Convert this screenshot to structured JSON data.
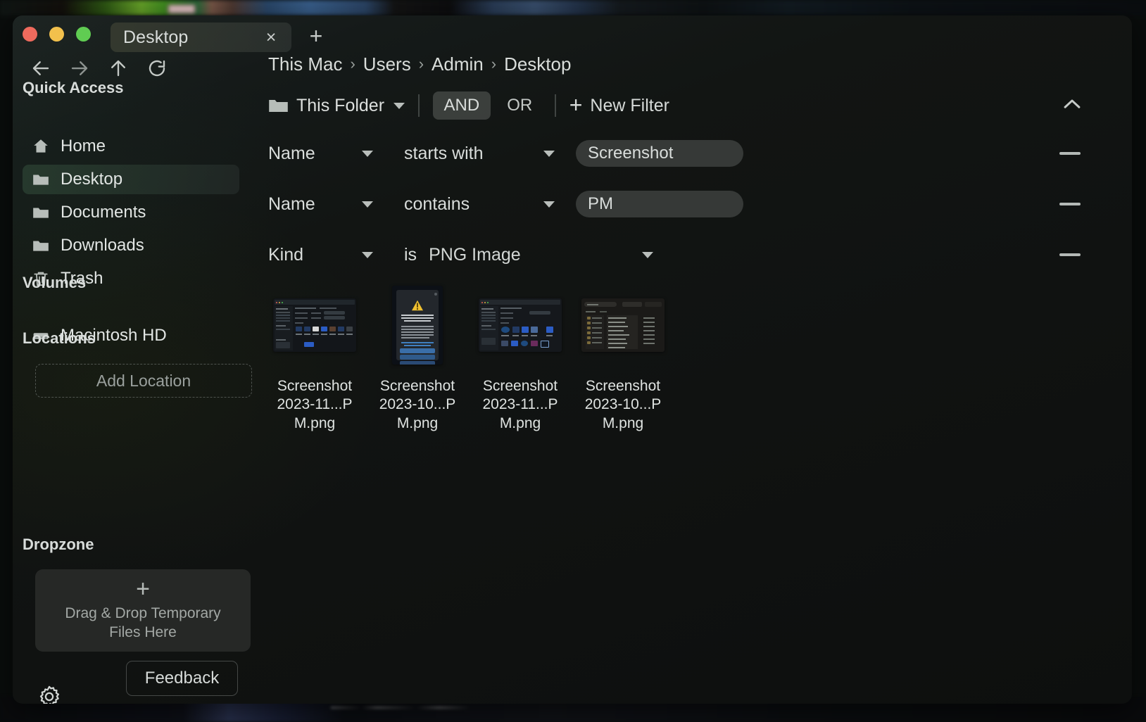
{
  "window": {
    "traffic_lights": [
      "close",
      "minimize",
      "maximize"
    ],
    "tab_label": "Desktop",
    "tab_close_glyph": "×",
    "new_tab_glyph": "+"
  },
  "nav": {
    "back": "back-arrow",
    "forward": "forward-arrow",
    "up": "up-arrow",
    "refresh": "refresh-arrow"
  },
  "breadcrumb": {
    "separator": "›",
    "items": [
      "This Mac",
      "Users",
      "Admin",
      "Desktop"
    ]
  },
  "filterbar": {
    "scope_label": "This Folder",
    "and_label": "AND",
    "or_label": "OR",
    "new_filter_label": "New Filter",
    "new_filter_plus": "+",
    "collapse_icon": "chevron-up-icon"
  },
  "filters": [
    {
      "field": "Name",
      "operator": "starts with",
      "value": "Screenshot",
      "value_type": "input"
    },
    {
      "field": "Name",
      "operator": "contains",
      "value": "PM",
      "value_type": "input"
    },
    {
      "field": "Kind",
      "operator": "is",
      "value": "PNG Image",
      "value_type": "dropdown"
    }
  ],
  "sidebar": {
    "sections": [
      {
        "title": "Quick Access"
      },
      {
        "title": "Volumes"
      },
      {
        "title": "Locations"
      },
      {
        "title": "Dropzone"
      }
    ],
    "quick_access": [
      {
        "label": "Home",
        "icon": "home-icon",
        "selected": false
      },
      {
        "label": "Desktop",
        "icon": "folder-icon",
        "selected": true
      },
      {
        "label": "Documents",
        "icon": "folder-icon",
        "selected": false
      },
      {
        "label": "Downloads",
        "icon": "folder-icon",
        "selected": false
      },
      {
        "label": "Trash",
        "icon": "trash-icon",
        "selected": false
      }
    ],
    "volumes": [
      {
        "label": "Macintosh HD",
        "icon": "drive-icon"
      }
    ],
    "add_location_label": "Add Location",
    "dropzone": {
      "plus": "+",
      "text": "Drag & Drop Temporary Files Here"
    },
    "settings_icon": "gear-icon",
    "feedback_label": "Feedback"
  },
  "files": [
    {
      "name": "Screenshot 2023-11...PM.png",
      "thumb": "file-browser-dark"
    },
    {
      "name": "Screenshot 2023-10...PM.png",
      "thumb": "gatekeeper-dialog"
    },
    {
      "name": "Screenshot 2023-11...PM.png",
      "thumb": "file-browser-grid"
    },
    {
      "name": "Screenshot 2023-10...PM.png",
      "thumb": "file-list-view"
    }
  ],
  "colors": {
    "window_bg": "#121513",
    "accent_selected": "#304a38",
    "text_primary": "#e2e6e4",
    "text_secondary": "#9aa09d",
    "traffic_close": "#ef6a5d",
    "traffic_min": "#f2c04c",
    "traffic_max": "#60cc52",
    "input_bg": "#3e4240",
    "warning_yellow": "#f0c030",
    "dialog_blue": "#3a6ea8"
  }
}
